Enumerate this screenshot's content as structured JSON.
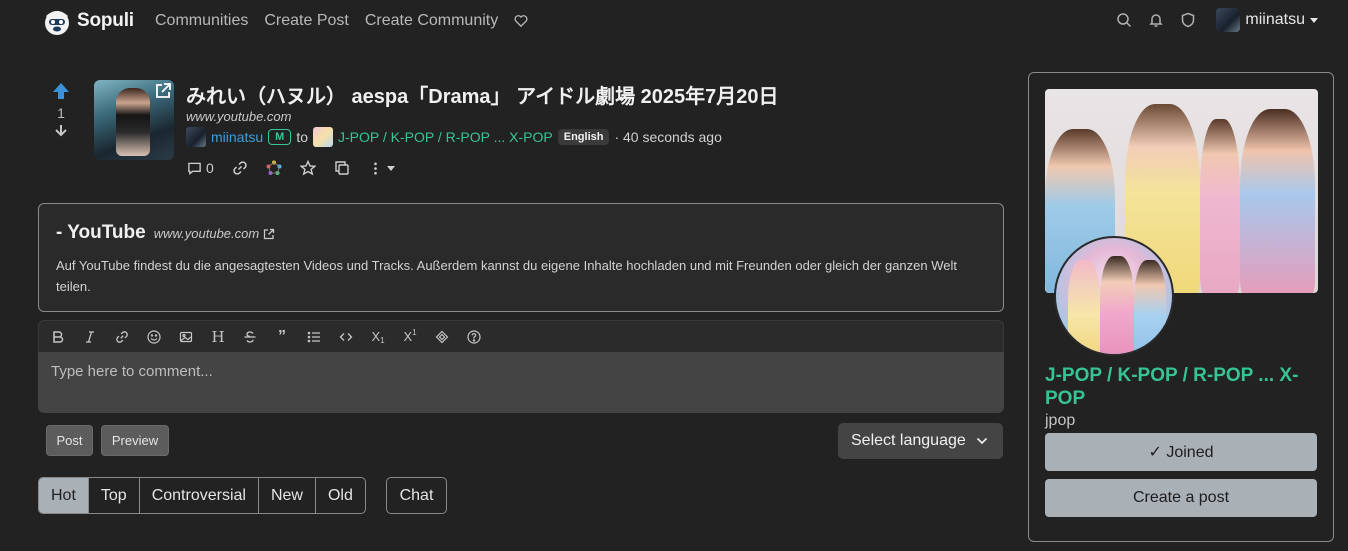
{
  "navbar": {
    "brand": "Sopuli",
    "links": [
      "Communities",
      "Create Post",
      "Create Community"
    ],
    "username": "miinatsu",
    "icons": [
      "search-icon",
      "bell-icon",
      "shield-icon",
      "heart-icon"
    ]
  },
  "post": {
    "score": "1",
    "title": "みれい（ハヌル） aespa「Drama」 アイドル劇場 2025年7月20日",
    "domain": "www.youtube.com",
    "author": "miinatsu",
    "mod_badge": "M",
    "to": "to",
    "community": "J-POP / K-POP / R-POP ... X-POP",
    "language": "English",
    "time": "· 40 seconds ago",
    "comment_count": "0"
  },
  "embed": {
    "title": "- YouTube",
    "domain": "www.youtube.com",
    "description": "Auf YouTube findest du die angesagtesten Videos und Tracks. Außerdem kannst du eigene Inhalte hochladen und mit Freunden oder gleich der ganzen Welt teilen."
  },
  "editor": {
    "placeholder": "Type here to comment...",
    "post_button": "Post",
    "preview_button": "Preview",
    "select_language": "Select language"
  },
  "sort_tabs": [
    "Hot",
    "Top",
    "Controversial",
    "New",
    "Old"
  ],
  "active_sort": "Hot",
  "chat_button": "Chat",
  "sidebar": {
    "community_name": "J-POP / K-POP / R-POP ... X-POP",
    "handle": "jpop",
    "joined_button": "✓ Joined",
    "create_post_button": "Create a post"
  },
  "colors": {
    "background": "#222222",
    "accent_green": "#36c495",
    "link_blue": "#3ba0e0",
    "upvote_blue": "#3b92d8",
    "button_gray": "#a9b0b6"
  }
}
